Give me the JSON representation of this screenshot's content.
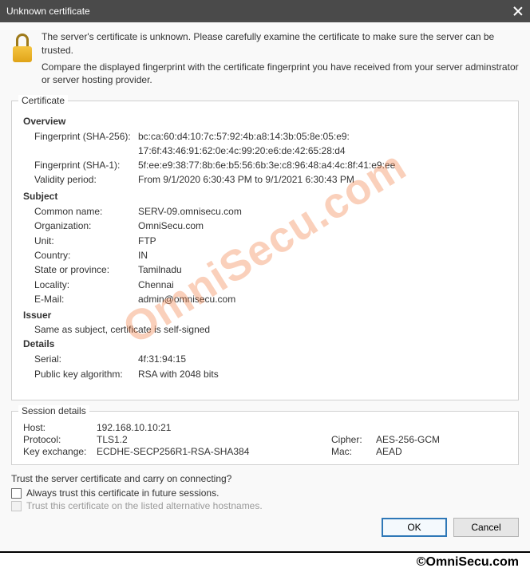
{
  "title": "Unknown certificate",
  "intro": {
    "line1": "The server's certificate is unknown. Please carefully examine the certificate to make sure the server can be trusted.",
    "line2": "Compare the displayed fingerprint with the certificate fingerprint you have received from your server adminstrator or server hosting provider."
  },
  "certificate": {
    "legend": "Certificate",
    "overview": {
      "heading": "Overview",
      "fingerprint_sha256_label": "Fingerprint (SHA-256):",
      "fingerprint_sha256_value_a": "bc:ca:60:d4:10:7c:57:92:4b:a8:14:3b:05:8e:05:e9:",
      "fingerprint_sha256_value_b": "17:6f:43:46:91:62:0e:4c:99:20:e6:de:42:65:28:d4",
      "fingerprint_sha1_label": "Fingerprint (SHA-1):",
      "fingerprint_sha1_value": "5f:ee:e9:38:77:8b:6e:b5:56:6b:3e:c8:96:48:a4:4c:8f:41:e9:ee",
      "validity_label": "Validity period:",
      "validity_value": "From 9/1/2020 6:30:43 PM to 9/1/2021 6:30:43 PM"
    },
    "subject": {
      "heading": "Subject",
      "common_name_label": "Common name:",
      "common_name_value": "SERV-09.omnisecu.com",
      "organization_label": "Organization:",
      "organization_value": "OmniSecu.com",
      "unit_label": "Unit:",
      "unit_value": "FTP",
      "country_label": "Country:",
      "country_value": "IN",
      "state_label": "State or province:",
      "state_value": "Tamilnadu",
      "locality_label": "Locality:",
      "locality_value": "Chennai",
      "email_label": "E-Mail:",
      "email_value": "admin@omnisecu.com"
    },
    "issuer": {
      "heading": "Issuer",
      "note": "Same as subject, certificate is self-signed"
    },
    "details": {
      "heading": "Details",
      "serial_label": "Serial:",
      "serial_value": "4f:31:94:15",
      "pubkey_label": "Public key algorithm:",
      "pubkey_value": "RSA with 2048 bits"
    }
  },
  "session": {
    "legend": "Session details",
    "host_label": "Host:",
    "host_value": "192.168.10.10:21",
    "protocol_label": "Protocol:",
    "protocol_value": "TLS1.2",
    "cipher_label": "Cipher:",
    "cipher_value": "AES-256-GCM",
    "key_exchange_label": "Key exchange:",
    "key_exchange_value": "ECDHE-SECP256R1-RSA-SHA384",
    "mac_label": "Mac:",
    "mac_value": "AEAD"
  },
  "trust": {
    "question": "Trust the server certificate and carry on connecting?",
    "always_label": "Always trust this certificate in future sessions.",
    "alternative_label": "Trust this certificate on the listed alternative hostnames."
  },
  "buttons": {
    "ok": "OK",
    "cancel": "Cancel"
  },
  "watermark": "OmniSecu.com",
  "footer": "©OmniSecu.com"
}
